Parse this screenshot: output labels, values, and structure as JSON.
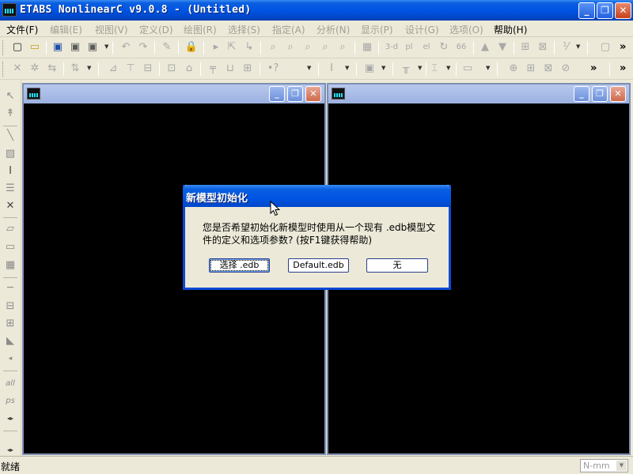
{
  "window": {
    "title": "ETABS NonlinearC v9.0.8 - (Untitled)",
    "minimize_glyph": "_",
    "maximize_glyph": "❐",
    "close_glyph": "✕"
  },
  "menu": [
    {
      "label": "文件(F)",
      "enabled": true
    },
    {
      "label": "编辑(E)",
      "enabled": false
    },
    {
      "label": "视图(V)",
      "enabled": false
    },
    {
      "label": "定义(D)",
      "enabled": false
    },
    {
      "label": "绘图(R)",
      "enabled": false
    },
    {
      "label": "选择(S)",
      "enabled": false
    },
    {
      "label": "指定(A)",
      "enabled": false
    },
    {
      "label": "分析(N)",
      "enabled": false
    },
    {
      "label": "显示(P)",
      "enabled": false
    },
    {
      "label": "设计(G)",
      "enabled": false
    },
    {
      "label": "选项(O)",
      "enabled": false
    },
    {
      "label": "帮助(H)",
      "enabled": true
    }
  ],
  "toolbar1": {
    "glyphs": [
      "▢",
      "▭",
      "▣",
      "↶",
      "↷",
      "✎",
      "🔒",
      "▸",
      "⇱",
      "↳",
      "⌕",
      "⌕",
      "⌕",
      "⌕",
      "⌕",
      "▦",
      "3-d",
      "pl",
      "el",
      "↻",
      "66",
      "▲",
      "▼",
      "⊞",
      "⊠",
      "⅟",
      "▢"
    ]
  },
  "toolbar2": {
    "glyphs": [
      "✕",
      "✲",
      "⇆",
      "⇅",
      "⊿",
      "⊤",
      "⊟",
      "⊡",
      "⌂",
      "╤",
      "⊔",
      "⊞",
      "•?",
      "I",
      "▣",
      "╥",
      "⌶",
      "▭",
      "⊕",
      "⊞",
      "⊠",
      "⊘"
    ]
  },
  "left_toolbar": {
    "glyphs": [
      "↖",
      "↟",
      "╲",
      "▧",
      "I",
      "☰",
      "✕",
      "▱",
      "▭",
      "▦",
      "─",
      "⊟",
      "⊞",
      "◣",
      "◂",
      "all",
      "ps",
      "◂▸",
      "◂▸"
    ]
  },
  "child_windows": [
    {
      "name": "left-view"
    },
    {
      "name": "right-view"
    }
  ],
  "dialog": {
    "title": "新模型初始化",
    "message": "您是否希望初始化新模型时使用从一个现有 .edb模型文件的定义和选项参数? (按F1键获得帮助)",
    "buttons": [
      {
        "label": "选择 .edb",
        "focused": true
      },
      {
        "label": "Default.edb",
        "focused": false
      },
      {
        "label": "无",
        "focused": false
      }
    ]
  },
  "status": {
    "text": "就绪",
    "units": "N-mm"
  },
  "colors": {
    "titlebar_blue": "#0054e3",
    "chrome": "#ece9d8",
    "canvas": "#000000",
    "inactive_title": "#9cb1e0"
  }
}
